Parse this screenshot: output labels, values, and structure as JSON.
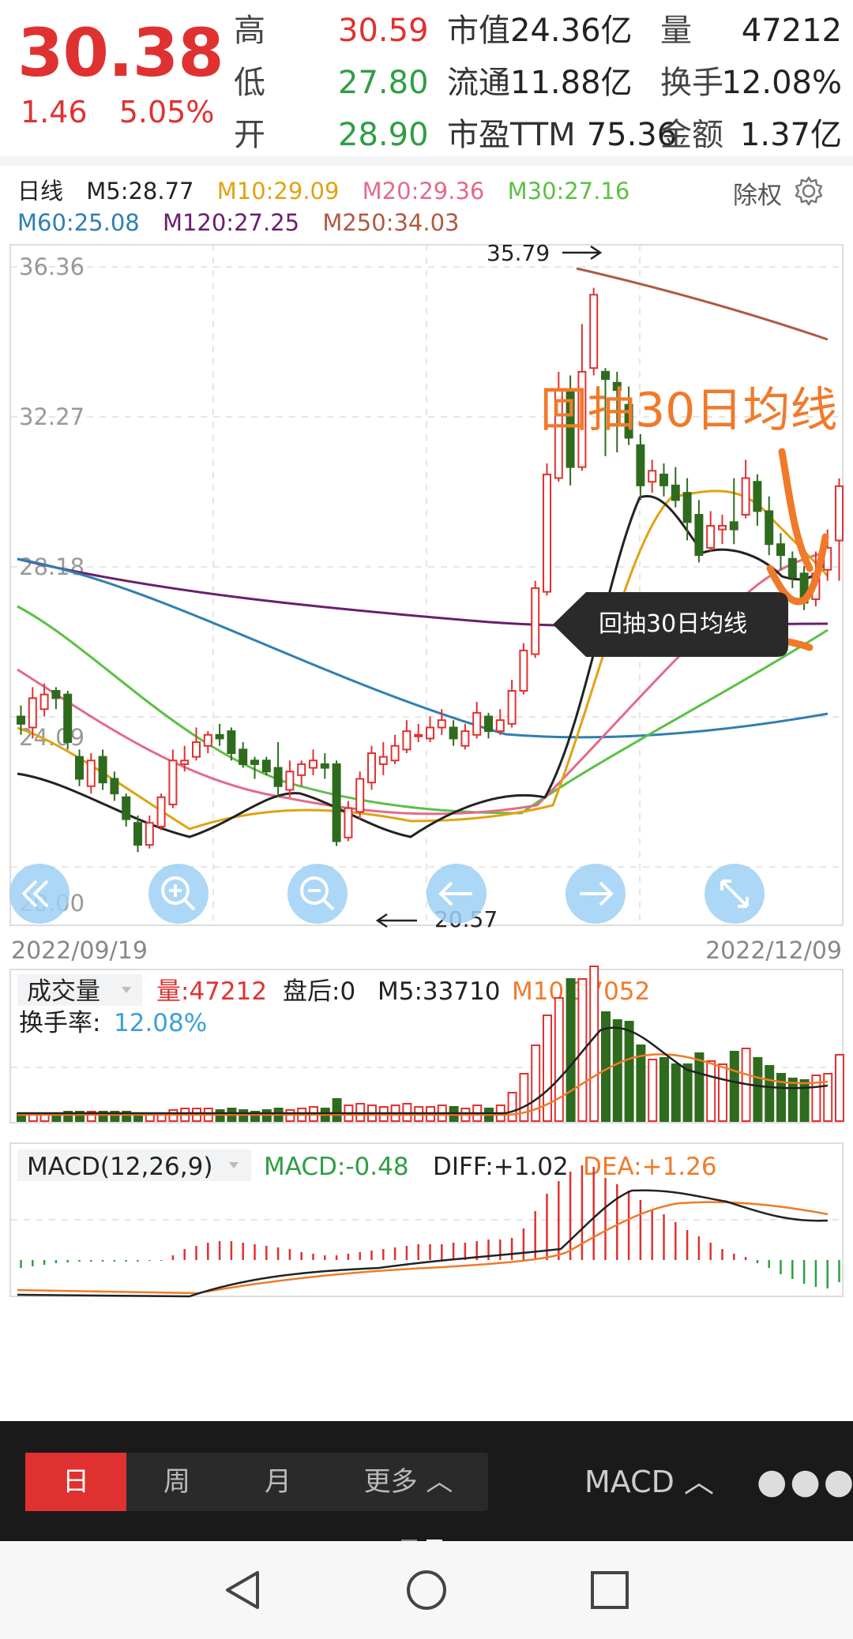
{
  "quote": {
    "price": "30.38",
    "change": "1.46",
    "change_pct": "5.05%",
    "labels": [
      "高",
      "低",
      "开"
    ],
    "values": [
      "30.59",
      "27.80",
      "28.90"
    ],
    "mid": [
      {
        "label": "市值",
        "value": "24.36亿"
      },
      {
        "label": "流通",
        "value": "11.88亿"
      },
      {
        "label": "市盈TTM",
        "value": "75.36"
      }
    ],
    "right_labels": [
      "量",
      "换手",
      "金额"
    ],
    "right_values": [
      "47212",
      "12.08%",
      "1.37亿"
    ]
  },
  "ma_legend": {
    "period": "日线",
    "items": [
      {
        "text": "M5:28.77",
        "color": "#222222"
      },
      {
        "text": "M10:29.09",
        "color": "#e0a310"
      },
      {
        "text": "M20:29.36",
        "color": "#e56a8a"
      },
      {
        "text": "M30:27.16",
        "color": "#5cc046"
      },
      {
        "text": "M60:25.08",
        "color": "#2f7fb0"
      },
      {
        "text": "M120:27.25",
        "color": "#6a1e6e"
      },
      {
        "text": "M250:34.03",
        "color": "#b05a42"
      }
    ],
    "adjust": "除权"
  },
  "price_axis": [
    "36.36",
    "32.27",
    "28.18",
    "24.09",
    "20.00"
  ],
  "annotations": {
    "high": "35.79",
    "low": "20.57",
    "title": "回抽30日均线",
    "tooltip": "回抽30日均线"
  },
  "dates": {
    "start": "2022/09/19",
    "end": "2022/12/09"
  },
  "volume": {
    "title": "成交量",
    "vol": "量:47212",
    "after": "盘后:0",
    "m5": "M5:33710",
    "m10": "M10:37052",
    "turnover_label": "换手率:",
    "turnover": "12.08%"
  },
  "macd": {
    "title": "MACD(12,26,9)",
    "macd": "MACD:-0.48",
    "diff": "DIFF:+1.02",
    "dea": "DEA:+1.26"
  },
  "colors": {
    "up": "#e03131",
    "down": "#2f6b1f",
    "ma5": "#222222",
    "ma10": "#e0a310",
    "ma20": "#e56a8a",
    "ma30": "#5cc046",
    "ma60": "#2f7fb0",
    "ma120": "#6a1e6e",
    "ma250": "#b05a42",
    "annotation": "#f07a2a"
  },
  "chart_data": {
    "type": "candlestick",
    "ylim": [
      20.0,
      36.36
    ],
    "candles": [
      [
        24.1,
        23.9,
        24.4,
        23.6
      ],
      [
        23.8,
        24.6,
        24.9,
        23.5
      ],
      [
        24.3,
        24.7,
        25.0,
        24.1
      ],
      [
        24.8,
        24.6,
        24.9,
        24.3
      ],
      [
        24.7,
        23.4,
        24.8,
        23.2
      ],
      [
        23.0,
        22.4,
        23.2,
        22.2
      ],
      [
        22.2,
        22.9,
        23.1,
        22.0
      ],
      [
        23.0,
        22.3,
        23.2,
        22.1
      ],
      [
        22.4,
        22.0,
        22.6,
        21.8
      ],
      [
        21.9,
        21.3,
        22.0,
        21.1
      ],
      [
        21.2,
        20.6,
        21.4,
        20.4
      ],
      [
        20.6,
        21.2,
        21.4,
        20.5
      ],
      [
        21.1,
        21.9,
        22.0,
        21.0
      ],
      [
        21.7,
        22.9,
        23.2,
        21.6
      ],
      [
        22.8,
        22.9,
        23.3,
        22.6
      ],
      [
        23.0,
        23.4,
        23.8,
        22.9
      ],
      [
        23.3,
        23.6,
        23.7,
        23.1
      ],
      [
        23.6,
        23.5,
        23.9,
        23.3
      ],
      [
        23.7,
        23.1,
        23.8,
        22.9
      ],
      [
        23.2,
        22.8,
        23.4,
        22.7
      ],
      [
        22.9,
        22.8,
        23.0,
        22.4
      ],
      [
        22.9,
        22.6,
        23.0,
        22.5
      ],
      [
        22.7,
        22.2,
        23.4,
        21.9
      ],
      [
        22.1,
        22.6,
        22.9,
        21.9
      ],
      [
        22.5,
        22.8,
        22.9,
        22.2
      ],
      [
        22.7,
        22.9,
        23.2,
        22.5
      ],
      [
        22.8,
        22.7,
        23.1,
        22.4
      ],
      [
        22.8,
        20.7,
        22.9,
        20.57
      ],
      [
        20.8,
        21.6,
        21.8,
        20.7
      ],
      [
        21.5,
        22.4,
        22.6,
        21.3
      ],
      [
        22.3,
        23.1,
        23.3,
        22.1
      ],
      [
        22.8,
        23.0,
        23.4,
        22.5
      ],
      [
        22.9,
        23.3,
        23.6,
        22.8
      ],
      [
        23.2,
        23.7,
        24.0,
        23.1
      ],
      [
        23.6,
        23.6,
        23.9,
        23.4
      ],
      [
        23.5,
        23.8,
        24.1,
        23.4
      ],
      [
        23.8,
        24.0,
        24.3,
        23.6
      ],
      [
        23.8,
        23.5,
        24.0,
        23.3
      ],
      [
        23.3,
        23.7,
        23.9,
        23.2
      ],
      [
        23.6,
        24.2,
        24.5,
        23.5
      ],
      [
        24.1,
        23.7,
        24.2,
        23.5
      ],
      [
        23.7,
        24.0,
        24.3,
        23.6
      ],
      [
        23.9,
        24.8,
        25.1,
        23.8
      ],
      [
        24.8,
        25.9,
        26.1,
        24.7
      ],
      [
        25.8,
        27.6,
        27.8,
        25.7
      ],
      [
        27.5,
        30.7,
        31.0,
        27.4
      ],
      [
        30.6,
        33.0,
        33.5,
        30.5
      ],
      [
        33.0,
        30.9,
        33.4,
        30.4
      ],
      [
        30.9,
        33.5,
        34.8,
        30.8
      ],
      [
        33.6,
        35.6,
        35.79,
        33.4
      ],
      [
        33.5,
        33.3,
        33.6,
        31.2
      ],
      [
        33.2,
        33.0,
        33.5,
        31.3
      ],
      [
        32.6,
        31.7,
        33.1,
        31.5
      ],
      [
        31.5,
        30.4,
        31.8,
        30.0
      ],
      [
        30.5,
        30.8,
        31.1,
        30.2
      ],
      [
        30.7,
        30.4,
        31.0,
        30.1
      ],
      [
        30.4,
        30.0,
        30.9,
        29.8
      ],
      [
        30.2,
        29.4,
        30.6,
        28.9
      ],
      [
        29.6,
        28.5,
        30.0,
        28.3
      ],
      [
        28.7,
        29.3,
        29.7,
        28.6
      ],
      [
        29.2,
        29.3,
        29.6,
        28.8
      ],
      [
        29.4,
        29.2,
        30.6,
        28.8
      ],
      [
        29.6,
        30.6,
        31.1,
        29.5
      ],
      [
        30.5,
        29.7,
        30.7,
        29.3
      ],
      [
        29.7,
        28.8,
        30.1,
        28.5
      ],
      [
        28.8,
        28.5,
        29.1,
        28.1
      ],
      [
        28.4,
        27.9,
        28.6,
        27.6
      ],
      [
        28.0,
        27.2,
        28.2,
        27.0
      ],
      [
        27.3,
        28.0,
        28.6,
        27.1
      ],
      [
        28.1,
        28.7,
        29.2,
        27.8
      ],
      [
        28.9,
        30.38,
        30.59,
        27.8
      ]
    ]
  }
}
